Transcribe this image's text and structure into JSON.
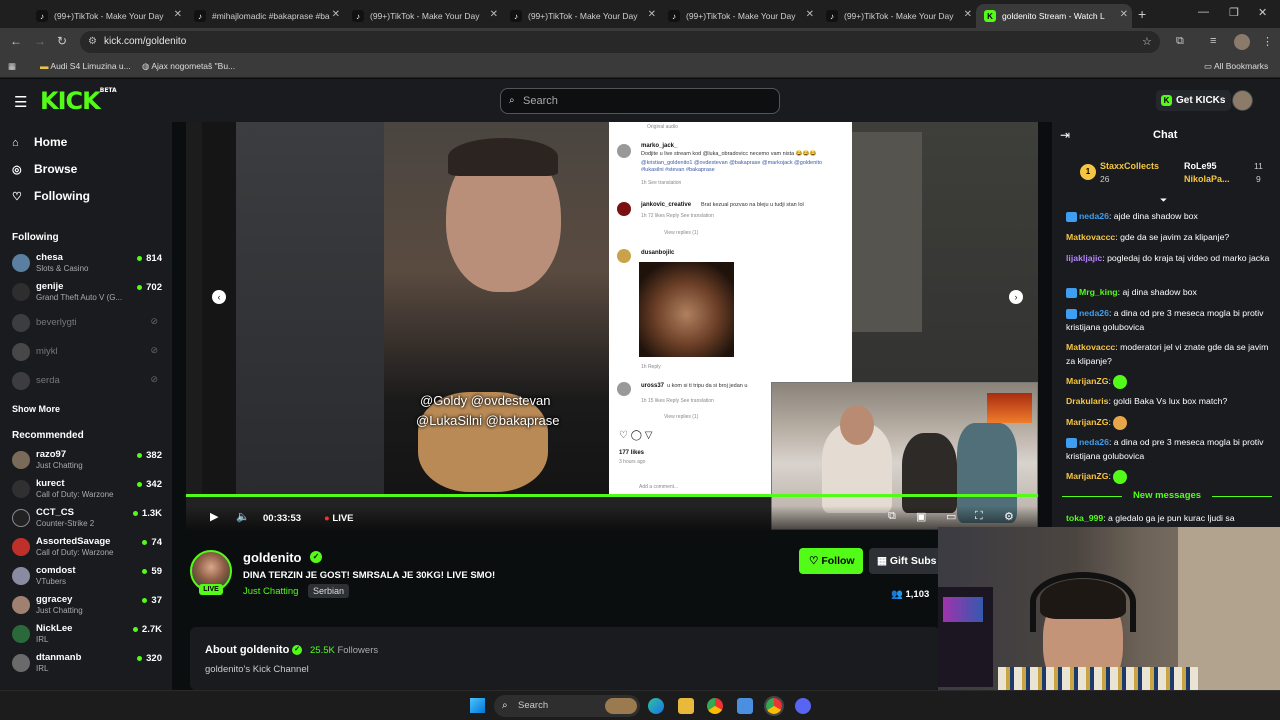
{
  "browser": {
    "tabs": [
      {
        "title": "(99+)TikTok - Make Your Day",
        "icon": "tiktok-icon"
      },
      {
        "title": "#mihajlomadic #bakaprase #ba",
        "icon": "tiktok-icon"
      },
      {
        "title": "(99+)TikTok - Make Your Day",
        "icon": "tiktok-icon"
      },
      {
        "title": "(99+)TikTok - Make Your Day",
        "icon": "tiktok-icon"
      },
      {
        "title": "(99+)TikTok - Make Your Day",
        "icon": "tiktok-icon"
      },
      {
        "title": "(99+)TikTok - Make Your Day",
        "icon": "tiktok-icon"
      },
      {
        "title": "goldenito Stream - Watch L",
        "icon": "kick-icon",
        "active": true
      }
    ],
    "url": "kick.com/goldenito",
    "bookmarks": [
      {
        "label": "Audi S4 Limuzina u..."
      },
      {
        "label": "Ajax nogometaš \"Bu..."
      }
    ],
    "all_bookmarks": "All Bookmarks"
  },
  "header": {
    "logo": "KICK",
    "logo_badge": "BETA",
    "search_placeholder": "Search",
    "get_kicks": "Get KICKs",
    "accent": "#53fc18"
  },
  "sidebar": {
    "nav": [
      {
        "label": "Home",
        "icon": "home-icon"
      },
      {
        "label": "Browse",
        "icon": "browse-icon"
      },
      {
        "label": "Following",
        "icon": "heart-icon"
      }
    ],
    "following_title": "Following",
    "following": [
      {
        "name": "chesa",
        "category": "Slots & Casino",
        "viewers": "814",
        "live": true,
        "color": "#5a7fa0"
      },
      {
        "name": "genije",
        "category": "Grand Theft Auto V (G...",
        "viewers": "702",
        "live": true,
        "color": "#2e2e2e"
      },
      {
        "name": "beverlygti",
        "live": false,
        "color": "#555"
      },
      {
        "name": "miykl",
        "live": false,
        "color": "#666"
      },
      {
        "name": "serda",
        "live": false,
        "color": "#555"
      }
    ],
    "show_more": "Show More",
    "recommended_title": "Recommended",
    "recommended": [
      {
        "name": "razo97",
        "category": "Just Chatting",
        "viewers": "382",
        "color": "#7a6a5a"
      },
      {
        "name": "kurect",
        "category": "Call of Duty: Warzone",
        "viewers": "342",
        "color": "#303030"
      },
      {
        "name": "CCT_CS",
        "category": "Counter-Strike 2",
        "viewers": "1.3K",
        "color": "#222"
      },
      {
        "name": "AssortedSavage",
        "category": "Call of Duty: Warzone",
        "viewers": "74",
        "color": "#c0302a"
      },
      {
        "name": "comdost",
        "category": "VTubers",
        "viewers": "59",
        "color": "#8a8aa0"
      },
      {
        "name": "ggracey",
        "category": "Just Chatting",
        "viewers": "37",
        "color": "#a08070"
      },
      {
        "name": "NickLee",
        "category": "IRL",
        "viewers": "2.7K",
        "color": "#2a6a3a"
      },
      {
        "name": "dtanmanb",
        "category": "IRL",
        "viewers": "320",
        "color": "#6a6a6a"
      }
    ]
  },
  "video": {
    "time": "00:33:53",
    "live_label": "LIVE",
    "caption_line1": "@Goldy @ovdestevan",
    "caption_line2": "@LukaSilni @bakaprase",
    "comments": [
      {
        "name": "marko_jack_",
        "text": "Dodjite u live stream kod @luka_obradovicc necemo vam nista 😂😂😂",
        "links": "@kristian_goldenito1 @ovdestevan @bakaprase @markojack @goldenito #lukasilni #stevan #bakaprase",
        "meta": "1h  See translation"
      },
      {
        "name": "jankovic_creative",
        "text": "Brat kezual pozvao na bleju u tudji stan lol",
        "meta": "1h  72 likes  Reply  See translation",
        "replies": "View replies (1)"
      },
      {
        "name": "dusanbojilc",
        "meta": "1h  Reply"
      },
      {
        "name": "uross37",
        "text": "u kom si ti tripu da si broj jedan u",
        "meta": "1h  15 likes  Reply  See translation",
        "replies": "View replies (1)"
      }
    ],
    "likes": "177 likes",
    "likes_time": "3 hours ago",
    "add_comment": "Add a comment...",
    "original_audio": "Original audio"
  },
  "stream": {
    "streamer": "goldenito",
    "title": "DINA TERZIN JE GOST! SMRSALA JE 30KG! LIVE SMO!",
    "category": "Just Chatting",
    "tag": "Serbian",
    "live_badge": "LIVE",
    "follow_label": "Follow",
    "gift_label": "Gift Subs",
    "viewers": "1,103"
  },
  "about": {
    "title": "About goldenito",
    "followers_count": "25.5K",
    "followers_label": "Followers",
    "description": "goldenito's Kick Channel"
  },
  "chat": {
    "title": "Chat",
    "pinned": [
      {
        "rank": "1",
        "name": "StaxxCollects",
        "count": "26"
      },
      {
        "rank": "",
        "name": "RoLe95",
        "count": "11"
      },
      {
        "rank": "",
        "name": "NikolaPa...",
        "count": "9"
      }
    ],
    "messages": [
      {
        "user": "neda26",
        "text": "ajde dina shadow box",
        "badge": true,
        "color": "#3e9ef0"
      },
      {
        "user": "Matkovaccc",
        "text": "gde da se javim za klipanje?",
        "badge": false,
        "color": "#f6c541"
      },
      {
        "user": "lijakljajic",
        "text": "pogledaj do kraja taj video od marko jacka",
        "badge": false,
        "color": "#b482ff"
      },
      {
        "user": "Mrg_king",
        "text": "aj dina shadow box",
        "badge": true,
        "color": "#53fc18"
      },
      {
        "user": "neda26",
        "text": "a dina od pre 3 meseca mogla bi protiv kristijana golubovica",
        "badge": true,
        "color": "#3e9ef0"
      },
      {
        "user": "Matkovaccc",
        "text": "moderatori jel vi znate gde da se javim za klipanje?",
        "badge": false,
        "color": "#f6c541"
      },
      {
        "user": "MarijanZG",
        "text": "",
        "emote": "green",
        "badge": false,
        "color": "#f6c541"
      },
      {
        "user": "Drakularis",
        "text": "goldi Baka Vs lux box match?",
        "badge": false,
        "color": "#f6c541"
      },
      {
        "user": "MarijanZG",
        "text": "",
        "emote": "red",
        "badge": false,
        "color": "#f6c541"
      },
      {
        "user": "neda26",
        "text": "a dina od pre 3 meseca mogla bi protiv kristijana golubovica",
        "badge": true,
        "color": "#3e9ef0"
      },
      {
        "user": "MarijanZG",
        "text": "",
        "emote": "green",
        "badge": false,
        "color": "#f6c541"
      }
    ],
    "new_messages": "New messages",
    "last_message": {
      "user": "toka_999",
      "text": "a gledalo ga je pun kurac ljudi sa",
      "color": "#53fc18"
    }
  },
  "taskbar": {
    "search_label": "Search"
  }
}
